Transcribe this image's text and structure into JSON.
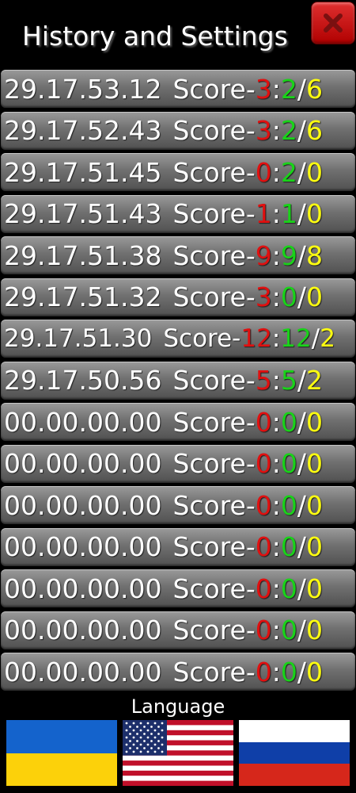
{
  "header": {
    "title": "History and Settings",
    "close_icon": "close-x-icon"
  },
  "history": [
    {
      "time": "29.17.53.12",
      "label": "Score-",
      "a": "3",
      "sep": ":",
      "b": "2",
      "slash": "/ ",
      "c": "6"
    },
    {
      "time": "29.17.52.43",
      "label": "Score-",
      "a": "3",
      "sep": ":",
      "b": "2",
      "slash": "/ ",
      "c": "6"
    },
    {
      "time": "29.17.51.45",
      "label": "Score-",
      "a": "0",
      "sep": ":",
      "b": "2",
      "slash": "/ ",
      "c": "0"
    },
    {
      "time": "29.17.51.43",
      "label": "Score-",
      "a": "1",
      "sep": ":",
      "b": "1",
      "slash": "/ ",
      "c": "0"
    },
    {
      "time": "29.17.51.38",
      "label": "Score-",
      "a": "9",
      "sep": ":",
      "b": "9",
      "slash": "/ ",
      "c": "8"
    },
    {
      "time": "29.17.51.32",
      "label": "Score-",
      "a": "3",
      "sep": ":",
      "b": "0",
      "slash": "/ ",
      "c": "0"
    },
    {
      "time": "29.17.51.30",
      "label": "Score-",
      "a": "12",
      "sep": ":",
      "b": "12",
      "slash": "/ ",
      "c": "2"
    },
    {
      "time": "29.17.50.56",
      "label": "Score-",
      "a": "5",
      "sep": ":",
      "b": "5",
      "slash": "/ ",
      "c": "2"
    },
    {
      "time": "00.00.00.00",
      "label": "Score-",
      "a": "0",
      "sep": ":",
      "b": "0",
      "slash": "/ ",
      "c": "0"
    },
    {
      "time": "00.00.00.00",
      "label": "Score-",
      "a": "0",
      "sep": ":",
      "b": "0",
      "slash": "/ ",
      "c": "0"
    },
    {
      "time": "00.00.00.00",
      "label": "Score-",
      "a": "0",
      "sep": ":",
      "b": "0",
      "slash": "/ ",
      "c": "0"
    },
    {
      "time": "00.00.00.00",
      "label": "Score-",
      "a": "0",
      "sep": ":",
      "b": "0",
      "slash": "/ ",
      "c": "0"
    },
    {
      "time": "00.00.00.00",
      "label": "Score-",
      "a": "0",
      "sep": ":",
      "b": "0",
      "slash": "/ ",
      "c": "0"
    },
    {
      "time": "00.00.00.00",
      "label": "Score-",
      "a": "0",
      "sep": ":",
      "b": "0",
      "slash": "/ ",
      "c": "0"
    },
    {
      "time": "00.00.00.00",
      "label": "Score-",
      "a": "0",
      "sep": ":",
      "b": "0",
      "slash": "/ ",
      "c": "0"
    }
  ],
  "colors": {
    "score_a": "#e01010",
    "score_b": "#19d319",
    "score_c": "#ffff10"
  },
  "language": {
    "label": "Language",
    "flags": [
      {
        "name": "ukraine-flag-icon"
      },
      {
        "name": "usa-flag-icon"
      },
      {
        "name": "russia-flag-icon"
      }
    ]
  }
}
